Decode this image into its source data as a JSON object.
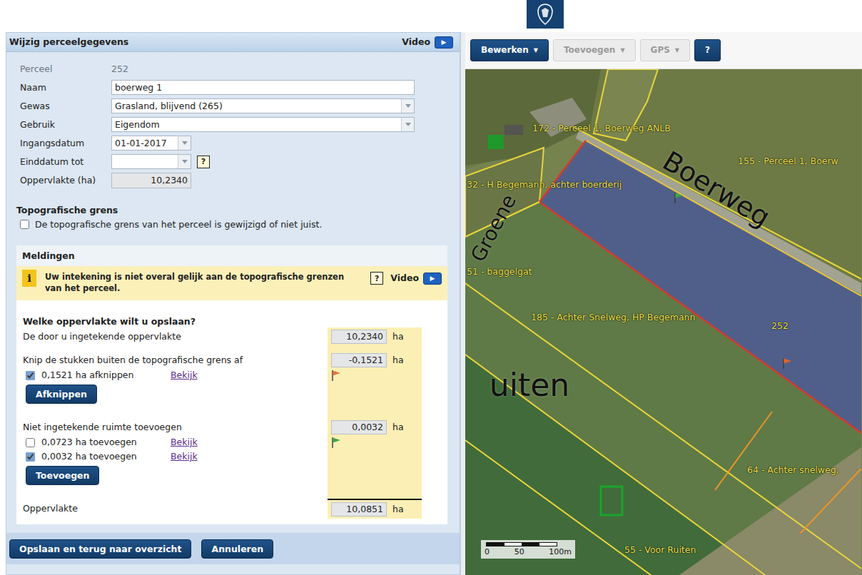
{
  "form": {
    "title": "Wijzig perceelgegevens",
    "video_label": "Video",
    "video_icon": "▶",
    "fields": [
      {
        "label": "Perceel",
        "value": "252",
        "kind": "static"
      },
      {
        "label": "Naam",
        "value": "boerweg 1",
        "kind": "text"
      },
      {
        "label": "Gewas",
        "value": "Grasland, blijvend (265)",
        "kind": "select"
      },
      {
        "label": "Gebruik",
        "value": "Eigendom",
        "kind": "select"
      },
      {
        "label": "Ingangsdatum",
        "value": "01-01-2017",
        "kind": "date"
      },
      {
        "label": "Einddatum tot",
        "value": "",
        "kind": "date",
        "help": "?"
      },
      {
        "label": "Oppervlakte (ha)",
        "value": "10,2340",
        "kind": "readonly"
      }
    ],
    "topo": {
      "title": "Topografische grens",
      "label": "De topografische grens van het perceel is gewijzigd of niet juist.",
      "checked": false
    },
    "meldingen": {
      "title": "Meldingen",
      "icon": "i",
      "message": "Uw intekening is niet overal gelijk aan de topografische grenzen van het perceel.",
      "help": "?",
      "video_label": "Video",
      "video_icon": "▶"
    },
    "area": {
      "question": "Welke oppervlakte wilt u opslaan?",
      "unit": "ha",
      "drawn": {
        "label": "De door u ingetekende oppervlakte",
        "value": "10,2340"
      },
      "cut": {
        "label": "Knip de stukken buiten de topografische grens af",
        "value": "-0,1521",
        "color": "#e8733a",
        "options": [
          {
            "label": "0,1521 ha afknippen",
            "link": "Bekijk",
            "checked": true
          }
        ],
        "button": "Afknippen"
      },
      "add": {
        "label": "Niet ingetekende ruimte toevoegen",
        "value": "0,0032",
        "color": "#3aa845",
        "options": [
          {
            "label": "0,0723 ha toevoegen",
            "link": "Bekijk",
            "checked": false
          },
          {
            "label": "0,0032 ha toevoegen",
            "link": "Bekijk",
            "checked": true
          }
        ],
        "button": "Toevoegen"
      },
      "total": {
        "label": "Oppervlakte",
        "value": "10,0851"
      }
    },
    "buttons": [
      "Opslaan en terug naar overzicht",
      "Annuleren"
    ]
  },
  "map": {
    "toolbar": [
      {
        "label": "Bewerken",
        "caret": "▼",
        "disabled": false
      },
      {
        "label": "Toevoegen",
        "caret": "▼",
        "disabled": true
      },
      {
        "label": "GPS",
        "caret": "▼",
        "disabled": true
      },
      {
        "label": "?",
        "disabled": false
      }
    ],
    "labels": [
      {
        "text": "172 - Perceel 1, Boerweg ANLB",
        "kind": "parcel"
      },
      {
        "text": "155 - Perceel 1, Boerw",
        "kind": "parcel"
      },
      {
        "text": "32 - H Begemann, achter boerderij",
        "kind": "parcel"
      },
      {
        "text": "51 - baggelgat",
        "kind": "parcel"
      },
      {
        "text": "185 - Achter Snelweg, HP Begemann",
        "kind": "parcel"
      },
      {
        "text": "252",
        "kind": "parcel"
      },
      {
        "text": "64 - Achter snelweg,",
        "kind": "parcel"
      },
      {
        "text": "55 - Voor Ruiten",
        "kind": "parcel"
      },
      {
        "text": "Boerweg",
        "kind": "street"
      },
      {
        "text": "Groene",
        "kind": "street"
      },
      {
        "text": "uiten",
        "kind": "street"
      }
    ],
    "flags": [
      {
        "color": "#3aa845"
      },
      {
        "color": "#e2632f"
      }
    ],
    "scale": {
      "ticks": [
        "0",
        "50",
        "100m"
      ]
    }
  }
}
